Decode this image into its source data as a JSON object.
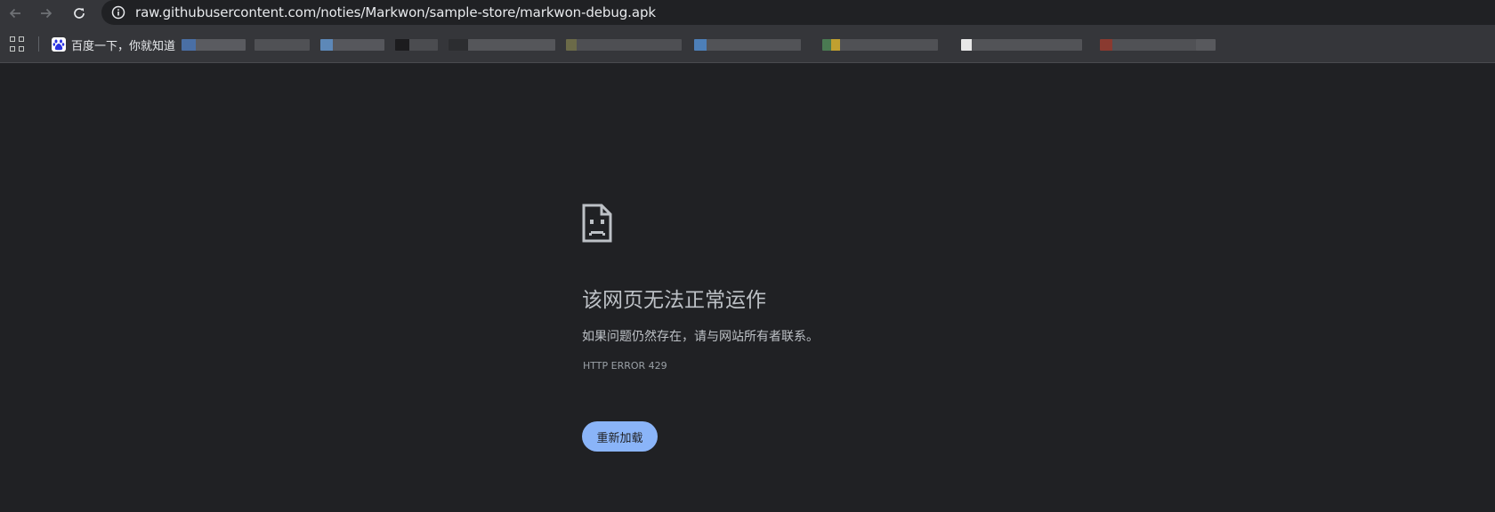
{
  "browser": {
    "url": "raw.githubusercontent.com/noties/Markwon/sample-store/markwon-debug.apk",
    "back_icon": "arrow-left-icon",
    "forward_icon": "arrow-right-icon",
    "reload_icon": "reload-icon",
    "site_info_icon": "info-circle-icon"
  },
  "bookmarks": {
    "items": [
      {
        "label": "百度一下，你就知道",
        "icon": "baidu-paw-icon"
      }
    ]
  },
  "error": {
    "icon": "sad-page-icon",
    "title": "该网页无法正常运作",
    "message": "如果问题仍然存在，请与网站所有者联系。",
    "code": "HTTP ERROR 429",
    "reload_label": "重新加载",
    "accent_color": "#8ab4f8"
  }
}
